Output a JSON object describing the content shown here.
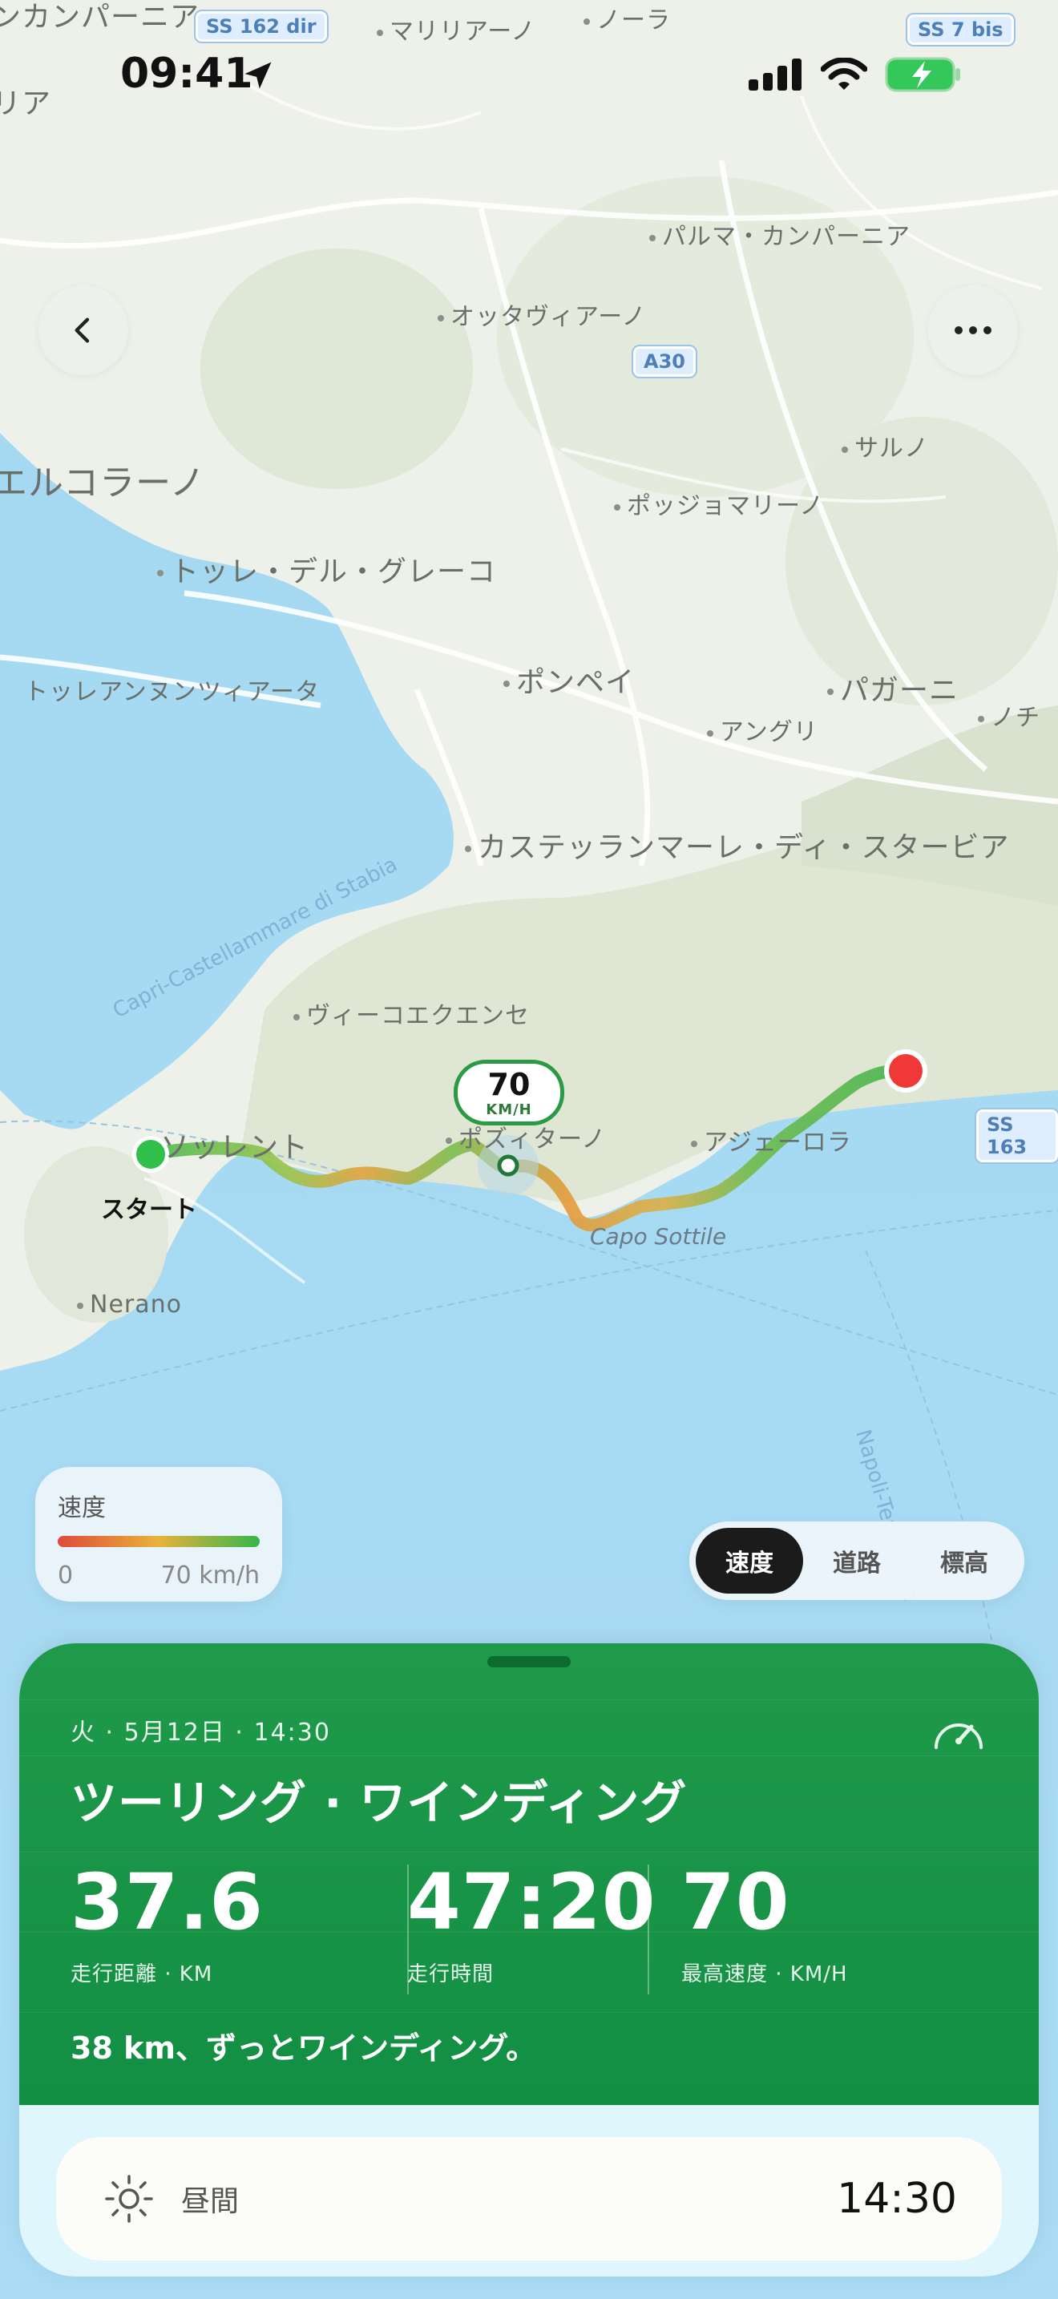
{
  "status_bar": {
    "time": "09:41"
  },
  "map": {
    "labels": [
      {
        "text": "ンカンパーニア",
        "dot": false,
        "size": "md"
      },
      {
        "text": "マリリアーノ",
        "dot": true,
        "size": "sm"
      },
      {
        "text": "ノーラ",
        "dot": true,
        "size": "sm"
      },
      {
        "text": "リア",
        "dot": false,
        "size": "md"
      },
      {
        "text": "パルマ・カンパーニア",
        "dot": true,
        "size": "sm"
      },
      {
        "text": "オッタヴィアーノ",
        "dot": true,
        "size": "sm"
      },
      {
        "text": "サルノ",
        "dot": true,
        "size": "sm"
      },
      {
        "text": "エルコラーノ",
        "dot": false,
        "size": "lg"
      },
      {
        "text": "ポッジョマリーノ",
        "dot": true,
        "size": "sm"
      },
      {
        "text": "トッレ・デル・グレーコ",
        "dot": true,
        "size": "md"
      },
      {
        "text": "トッレアンヌンツィアータ",
        "dot": false,
        "size": "sm"
      },
      {
        "text": "ポンペイ",
        "dot": true,
        "size": "md"
      },
      {
        "text": "パガーニ",
        "dot": true,
        "size": "md"
      },
      {
        "text": "アングリ",
        "dot": true,
        "size": "sm"
      },
      {
        "text": "ノチ",
        "dot": true,
        "size": "sm"
      },
      {
        "text": "カステッランマーレ・ディ・スタービア",
        "dot": true,
        "size": "md"
      },
      {
        "text": "ヴィーコエクエンセ",
        "dot": true,
        "size": "sm"
      },
      {
        "text": "ソッレント",
        "dot": false,
        "size": "md"
      },
      {
        "text": "ポズィターノ",
        "dot": true,
        "size": "sm"
      },
      {
        "text": "アジェーロラ",
        "dot": true,
        "size": "sm"
      },
      {
        "text": "Nerano",
        "dot": true,
        "size": "sm"
      }
    ],
    "road_shields": [
      "SS 162 dir",
      "SS 7 bis",
      "A30",
      "SS 163"
    ],
    "water_labels": [
      "Capri-Castellammare di Stabia",
      "Napoli-Teul...rese"
    ],
    "cape_label": "Capo Sottile",
    "start_label": "スタート",
    "callout": {
      "value": "70",
      "unit": "KM/H"
    }
  },
  "legend": {
    "title": "速度",
    "min": "0",
    "max": "70 km/h",
    "colors": [
      "#e04a3a",
      "#e8b43a",
      "#35b54a"
    ]
  },
  "segments": {
    "items": [
      "速度",
      "道路",
      "標高"
    ],
    "active": 0
  },
  "trip": {
    "date": "火 · 5月12日 · 14:30",
    "title": "ツーリング · ワインディング",
    "stats": [
      {
        "value": "37.6",
        "label": "走行距離 · KM"
      },
      {
        "value": "47:20",
        "label": "走行時間"
      },
      {
        "value": "70",
        "label": "最高速度 · KM/H"
      }
    ],
    "description": "38 km、ずっとワインディング。",
    "accent_color": "#1a9848"
  },
  "time_card": {
    "icon": "sun-icon",
    "label": "昼間",
    "value": "14:30"
  }
}
